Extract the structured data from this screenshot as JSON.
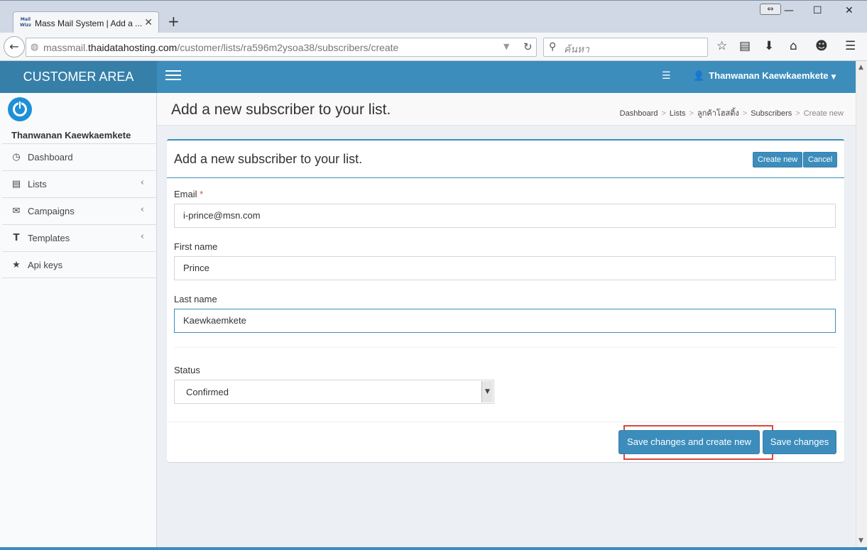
{
  "browser": {
    "tab_title": "Mass Mail System | Add a ...",
    "favicon_text": "Mail Wizz",
    "url_prefix": "massmail.",
    "url_domain": "thaidatahosting.com",
    "url_path": "/customer/lists/ra596m2ysoa38/subscribers/create",
    "search_placeholder": "ค้นหา"
  },
  "header": {
    "brand": "CUSTOMER AREA",
    "user_name": "Thanwanan Kaewkaemkete"
  },
  "sidebar": {
    "user_name": "Thanwanan Kaewkaemkete",
    "items": [
      {
        "label": "Dashboard",
        "icon": "dashboard-icon",
        "has_submenu": false
      },
      {
        "label": "Lists",
        "icon": "list-icon",
        "has_submenu": true
      },
      {
        "label": "Campaigns",
        "icon": "envelope-icon",
        "has_submenu": true
      },
      {
        "label": "Templates",
        "icon": "text-icon",
        "has_submenu": true
      },
      {
        "label": "Api keys",
        "icon": "star-icon",
        "has_submenu": false
      }
    ]
  },
  "page": {
    "title": "Add a new subscriber to your list.",
    "breadcrumb": [
      "Dashboard",
      "Lists",
      "ลูกค้าโฮสติ้ง",
      "Subscribers",
      "Create new"
    ]
  },
  "form": {
    "title": "Add a new subscriber to your list.",
    "create_new_label": "Create new",
    "cancel_label": "Cancel",
    "email_label": "Email",
    "email_required_mark": "*",
    "email_value": "i-prince@msn.com",
    "first_name_label": "First name",
    "first_name_value": "Prince",
    "last_name_label": "Last name",
    "last_name_value": "Kaewkaemkete",
    "status_label": "Status",
    "status_value": "Confirmed",
    "save_and_new_label": "Save changes and create new",
    "save_label": "Save changes"
  },
  "colors": {
    "primary": "#3c8dbc",
    "logo_bg": "#367fa9",
    "highlight": "#e0453a"
  }
}
